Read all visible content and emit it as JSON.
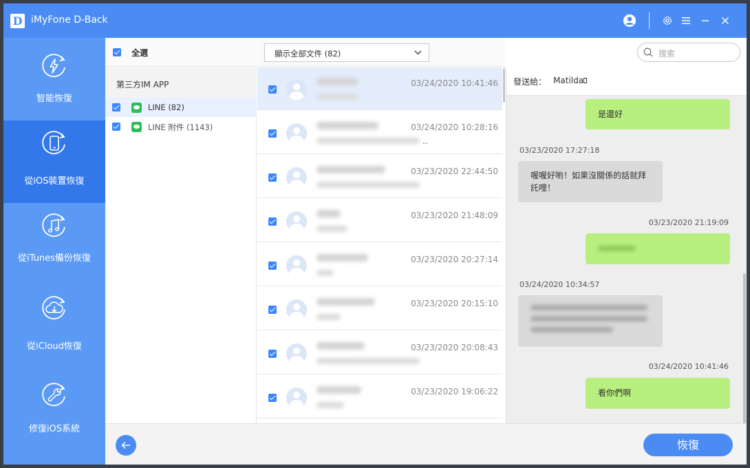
{
  "app": {
    "logo_letter": "D",
    "title": "iMyFone D-Back"
  },
  "titlebar": {
    "icons": [
      "account-icon",
      "gear-icon",
      "menu-icon",
      "minimize-icon",
      "close-icon"
    ]
  },
  "sidebar": {
    "items": [
      {
        "label": "智能恢復",
        "icon": "lightning-refresh-icon",
        "active": false
      },
      {
        "label": "從iOS裝置恢復",
        "icon": "phone-refresh-icon",
        "active": true
      },
      {
        "label": "從iTunes備份恢復",
        "icon": "music-note-refresh-icon",
        "active": false
      },
      {
        "label": "從iCloud恢復",
        "icon": "cloud-download-icon",
        "active": false
      },
      {
        "label": "修復iOS系統",
        "icon": "wrench-icon",
        "active": false
      }
    ]
  },
  "categories": {
    "select_all": "全選",
    "group_title": "第三方IM APP",
    "items": [
      {
        "label": "LINE (82)",
        "checked": true,
        "selected": true
      },
      {
        "label": "LINE 附件 (1143)",
        "checked": true,
        "selected": false
      }
    ]
  },
  "filter": {
    "selected": "顯示全部文件 (82)"
  },
  "search": {
    "placeholder": "搜索"
  },
  "conversations": [
    {
      "time": "03/24/2020 10:41:46",
      "selected": true
    },
    {
      "time": "03/24/2020 10:28:16",
      "selected": false,
      "sub_suffix": ".."
    },
    {
      "time": "03/23/2020 22:44:50",
      "selected": false
    },
    {
      "time": "03/23/2020 21:48:09",
      "selected": false
    },
    {
      "time": "03/23/2020 20:27:14",
      "selected": false
    },
    {
      "time": "03/23/2020 20:15:10",
      "selected": false
    },
    {
      "time": "03/23/2020 20:08:43",
      "selected": false
    },
    {
      "time": "03/23/2020 19:06:22",
      "selected": false
    }
  ],
  "chat": {
    "send_to_label": "發送給：",
    "recipient": "Matilda",
    "messages": [
      {
        "dir": "out",
        "text": "是還好",
        "time": ""
      },
      {
        "dir": "in",
        "text": "喔喔好喲！如果沒關係的話就拜託哩！",
        "time": "03/23/2020 17:27:18"
      },
      {
        "dir": "out",
        "text": "",
        "time": "03/23/2020 21:19:09"
      },
      {
        "dir": "in",
        "text": "",
        "time": "03/24/2020 10:34:57"
      },
      {
        "dir": "out",
        "text": "看你們啊",
        "time": "03/24/2020 10:41:46"
      }
    ]
  },
  "bottom": {
    "recover_label": "恢復"
  },
  "colors": {
    "brand_blue": "#4a8cf3",
    "sidebar_active": "#3378ea",
    "bubble_out": "#b7f07f",
    "bubble_in": "#dadada"
  }
}
